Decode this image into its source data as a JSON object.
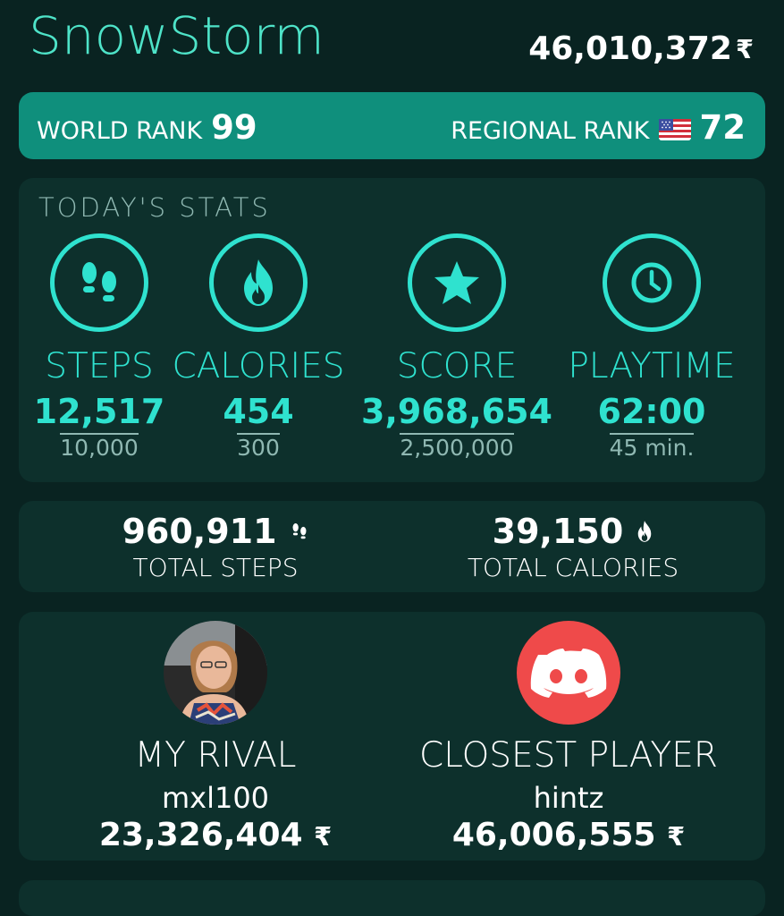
{
  "header": {
    "username": "SnowStorm",
    "coins": "46,010,372",
    "coin_symbol": "₹"
  },
  "ranks": {
    "world_label": "WORLD RANK",
    "world_value": "99",
    "regional_label": "REGIONAL RANK",
    "regional_value": "72"
  },
  "today": {
    "title": "TODAY'S STATS",
    "stats": [
      {
        "label": "STEPS",
        "value": "12,517",
        "goal": "10,000",
        "icon": "footsteps-icon"
      },
      {
        "label": "CALORIES",
        "value": "454",
        "goal": "300",
        "icon": "flame-icon"
      },
      {
        "label": "SCORE",
        "value": "3,968,654",
        "goal": "2,500,000",
        "icon": "star-icon"
      },
      {
        "label": "PLAYTIME",
        "value": "62:00",
        "goal": "45 min.",
        "icon": "clock-icon"
      }
    ]
  },
  "totals": {
    "steps_value": "960,911",
    "steps_label": "TOTAL STEPS",
    "calories_value": "39,150",
    "calories_label": "TOTAL CALORIES"
  },
  "players": {
    "rival_title": "MY RIVAL",
    "rival_name": "mxl100",
    "rival_score": "23,326,404",
    "closest_title": "CLOSEST PLAYER",
    "closest_name": "hintz",
    "closest_score": "46,006,555"
  },
  "colors": {
    "background": "#092321",
    "accent": "#2fe2cf",
    "rank_bar": "#0f8f7c",
    "discord": "#ef4a4a"
  }
}
